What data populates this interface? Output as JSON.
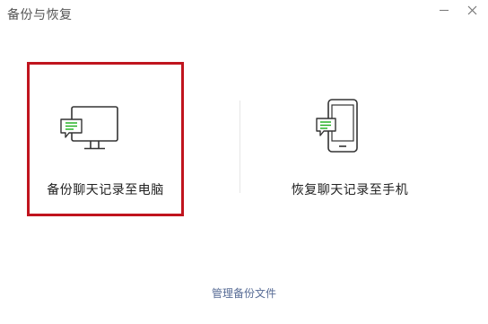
{
  "window": {
    "title": "备份与恢复"
  },
  "options": {
    "backup_label": "备份聊天记录至电脑",
    "restore_label": "恢复聊天记录至手机"
  },
  "footer": {
    "manage_label": "管理备份文件"
  },
  "icons": {
    "minimize": "minimize-icon",
    "close": "close-icon",
    "backup": "computer-chat-icon",
    "restore": "phone-chat-icon"
  },
  "colors": {
    "selection_border": "#c0141e",
    "chat_green": "#1aad19",
    "link": "#576b95"
  }
}
